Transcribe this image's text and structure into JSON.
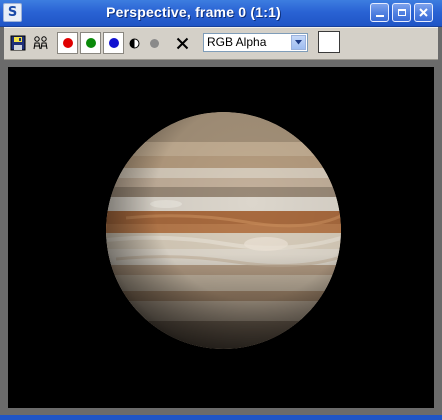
{
  "window": {
    "title": "Perspective, frame 0 (1:1)",
    "app_icon_glyph": "S",
    "buttons": {
      "minimize": "minimize-icon",
      "maximize": "maximize-icon",
      "close": "close-icon"
    }
  },
  "toolbar": {
    "channel_red": {
      "icon": "red-channel-icon",
      "color": "#e00000"
    },
    "channel_green": {
      "icon": "green-channel-icon",
      "color": "#0a8a0a"
    },
    "channel_blue": {
      "icon": "blue-channel-icon",
      "color": "#1010d0"
    },
    "channel_select": {
      "value": "RGB Alpha"
    },
    "swatch_color": "#ffffff"
  },
  "viewport": {
    "background": "#000000",
    "content": "planet-render"
  },
  "colors": {
    "titlebar": "#2a63d4",
    "toolbar": "#d4d0c8",
    "frame": "#6b6b6b"
  }
}
